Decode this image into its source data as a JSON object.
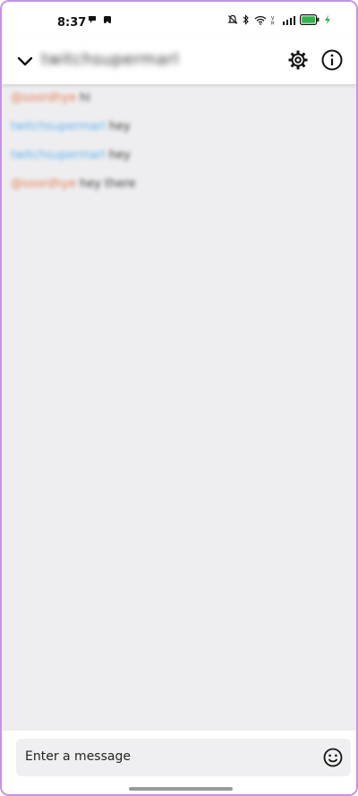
{
  "status": {
    "time": "8:37",
    "icons": [
      "chat-notification-icon",
      "app-notification-icon",
      "mute-icon",
      "bluetooth-icon",
      "wifi-icon",
      "volte-icon",
      "signal-icon",
      "battery-icon",
      "charging-icon"
    ]
  },
  "header": {
    "title": "twitchsupermarl",
    "back_icon": "chevron-down-icon",
    "settings_icon": "gear-icon",
    "info_icon": "info-icon"
  },
  "messages": [
    {
      "user": "@soordhye",
      "text": "hi",
      "color": "#e8794f"
    },
    {
      "user": "twitchsupermarl",
      "text": "hey",
      "color": "#5fb0ee"
    },
    {
      "user": "twitchsupermarl",
      "text": "hey",
      "color": "#5fb0ee"
    },
    {
      "user": "@soordhye",
      "text": "hey there",
      "color": "#e8794f"
    }
  ],
  "composer": {
    "placeholder": "Enter a message",
    "emoji_icon": "emoji-icon"
  },
  "colors": {
    "chat_background": "#eeeef0",
    "frame_border": "#c792e8",
    "battery_green": "#34b34a"
  }
}
